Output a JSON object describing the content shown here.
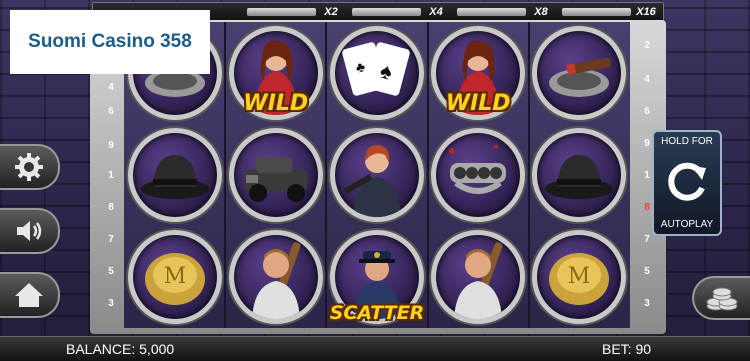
{
  "logo": {
    "text": "Suomi Casino 358"
  },
  "multiplier_bar": {
    "title": "",
    "multipliers": [
      "X2",
      "X4",
      "X8",
      "X16"
    ]
  },
  "reels": [
    [
      {
        "symbol": "cigar-ashtray",
        "label": ""
      },
      {
        "symbol": "fedora-hat",
        "label": ""
      },
      {
        "symbol": "gold-ring",
        "label": ""
      }
    ],
    [
      {
        "symbol": "woman-wild",
        "label": "WILD"
      },
      {
        "symbol": "vintage-car",
        "label": ""
      },
      {
        "symbol": "thug-with-bat",
        "label": ""
      }
    ],
    [
      {
        "symbol": "playing-cards",
        "label": ""
      },
      {
        "symbol": "gangster-woman",
        "label": ""
      },
      {
        "symbol": "policeman-scatter",
        "label": "SCATTER"
      }
    ],
    [
      {
        "symbol": "woman-wild",
        "label": "WILD"
      },
      {
        "symbol": "brass-knuckles",
        "label": ""
      },
      {
        "symbol": "thug-with-bat",
        "label": ""
      }
    ],
    [
      {
        "symbol": "cigar-ashtray",
        "label": ""
      },
      {
        "symbol": "fedora-hat",
        "label": ""
      },
      {
        "symbol": "gold-ring",
        "label": ""
      }
    ]
  ],
  "paylines_left": [
    "4",
    "6",
    "9",
    "1",
    "8",
    "7",
    "5",
    "3"
  ],
  "paylines_right": [
    "2",
    "4",
    "6",
    "9",
    "1",
    "8",
    "7",
    "5",
    "3"
  ],
  "autoplay": {
    "line1": "HOLD FOR",
    "line2": "AUTOPLAY"
  },
  "footer": {
    "balance": "BALANCE: 5,000",
    "bet": "BET: 90"
  },
  "colors": {
    "wild_text": "#ffd21a",
    "frame": "#c9c9c9",
    "background": "#2a2440"
  }
}
